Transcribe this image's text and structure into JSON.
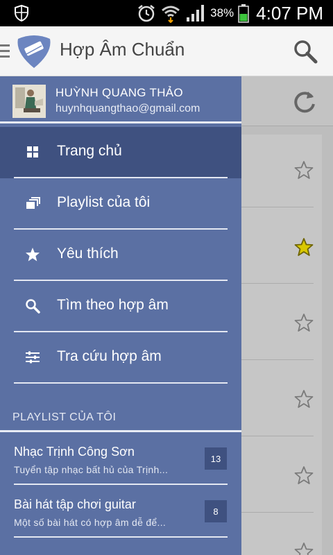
{
  "status_bar": {
    "battery_text": "38%",
    "time": "4:07 PM",
    "icons": [
      "shield-icon",
      "alarm-icon",
      "wifi-icon",
      "signal-icon",
      "battery-icon"
    ]
  },
  "app_bar": {
    "title": "Hợp Âm Chuẩn",
    "logo_icon": "guitar-pick-logo",
    "search_icon": "search-icon"
  },
  "background_list": {
    "refresh_icon": "refresh-icon",
    "stars": [
      false,
      true,
      false,
      false,
      false,
      false
    ],
    "colors": {
      "star_active": "#d9c800",
      "star_inactive": "#7a7a7a"
    }
  },
  "drawer": {
    "user": {
      "name": "HUỲNH QUANG THẢO",
      "email": "huynhquangthao@gmail.com"
    },
    "nav_items": [
      {
        "label": "Trang chủ",
        "icon": "grid-icon",
        "active": true
      },
      {
        "label": "Playlist của tôi",
        "icon": "playlist-icon",
        "active": false
      },
      {
        "label": "Yêu thích",
        "icon": "star-icon",
        "active": false
      },
      {
        "label": "Tìm theo hợp âm",
        "icon": "search-icon",
        "active": false
      },
      {
        "label": "Tra cứu hợp âm",
        "icon": "sliders-icon",
        "active": false
      }
    ],
    "playlist_section_title": "PLAYLIST CỦA TÔI",
    "playlists": [
      {
        "title": "Nhạc Trịnh Công Sơn",
        "description": "Tuyển tập nhạc bất hủ của Trịnh...",
        "count": "13"
      },
      {
        "title": "Bài hát tập chơi guitar",
        "description": "Một số bài hát có hợp âm dễ để...",
        "count": "8"
      }
    ],
    "colors": {
      "background": "#5b70a3",
      "active": "#3f5180",
      "divider": "#e4e8f2"
    }
  }
}
